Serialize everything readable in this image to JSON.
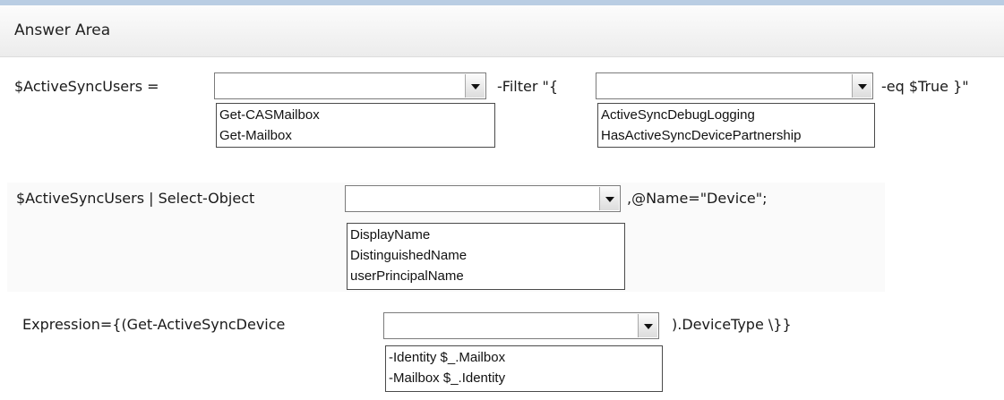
{
  "header": {
    "title": "Answer Area"
  },
  "line1": {
    "prefix": "$ActiveSyncUsers =",
    "middle": "-Filter \"{",
    "suffix": "-eq $True }\"",
    "dropdown1": {
      "selected": "",
      "options": [
        "Get-CASMailbox",
        "Get-Mailbox"
      ]
    },
    "dropdown2": {
      "selected": "",
      "options": [
        "ActiveSyncDebugLogging",
        "HasActiveSyncDevicePartnership"
      ]
    }
  },
  "line2": {
    "prefix": "$ActiveSyncUsers | Select-Object",
    "suffix": ",@Name=\"Device\";",
    "dropdown": {
      "selected": "",
      "options": [
        "DisplayName",
        "DistinguishedName",
        "userPrincipalName"
      ]
    }
  },
  "line3": {
    "prefix": "Expression={(Get-ActiveSyncDevice",
    "suffix": ").DeviceType \\}}",
    "dropdown": {
      "selected": "",
      "options": [
        "-Identity $_.Mailbox",
        "-Mailbox $_.Identity"
      ]
    }
  },
  "icons": {
    "dropdown_arrow": "chevron-down-icon"
  },
  "colors": {
    "top_stripe": "#b9cde3",
    "header_bg": "#f0f0f0",
    "border": "#7b7b7b"
  }
}
